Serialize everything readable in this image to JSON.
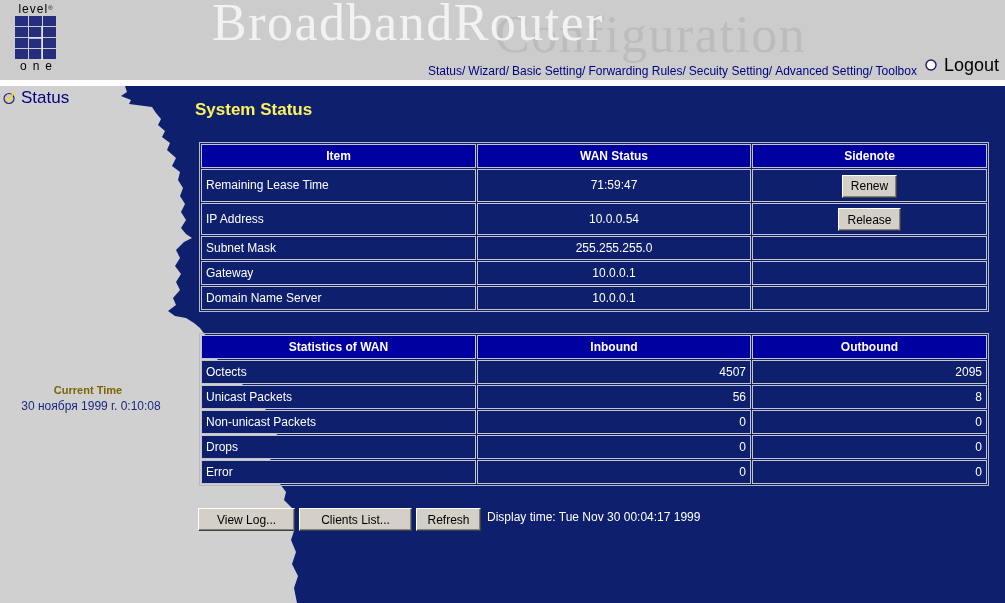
{
  "header": {
    "logo": {
      "top": "level$^{®}$",
      "bottom": "one"
    },
    "title": "BroadbandRouter",
    "subtitle": "Configuration",
    "nav": [
      {
        "label": "Status/"
      },
      {
        "label": "Wizard/"
      },
      {
        "label": "Basic Setting/"
      },
      {
        "label": "Forwarding Rules/"
      },
      {
        "label": "Secuity Setting/"
      },
      {
        "label": "Advanced Setting/"
      },
      {
        "label": "Toolbox"
      }
    ],
    "logout": "Logout"
  },
  "sidebar": {
    "items": [
      {
        "label": "Status",
        "selected": true
      }
    ],
    "current_time": {
      "label": "Current Time",
      "value": "30 ноября 1999 г. 0:10:08"
    }
  },
  "main": {
    "title": "System Status",
    "wan_table": {
      "columns": [
        "Item",
        "WAN Status",
        "Sidenote"
      ],
      "rows": [
        {
          "cells": [
            "Remaining Lease Time",
            "71:59:47"
          ],
          "action": "Renew"
        },
        {
          "cells": [
            "IP Address",
            "10.0.0.54"
          ],
          "action": "Release"
        },
        {
          "cells": [
            "Subnet Mask",
            "255.255.255.0"
          ]
        },
        {
          "cells": [
            "Gateway",
            "10.0.0.1"
          ]
        },
        {
          "cells": [
            "Domain Name Server",
            "10.0.0.1"
          ]
        }
      ]
    },
    "stats_table": {
      "columns": [
        "Statistics of WAN",
        "Inbound",
        "Outbound"
      ],
      "rows": [
        {
          "cells": [
            "Octects",
            "4507",
            "2095"
          ]
        },
        {
          "cells": [
            "Unicast Packets",
            "56",
            "8"
          ]
        },
        {
          "cells": [
            "Non-unicast Packets",
            "0",
            "0"
          ]
        },
        {
          "cells": [
            "Drops",
            "0",
            "0"
          ]
        },
        {
          "cells": [
            "Error",
            "0",
            "0"
          ]
        }
      ]
    },
    "buttons": [
      "View Log...",
      "Clients List...",
      "Refresh"
    ],
    "display_time": "Display time: Tue Nov 30 00:04:17 1999"
  }
}
